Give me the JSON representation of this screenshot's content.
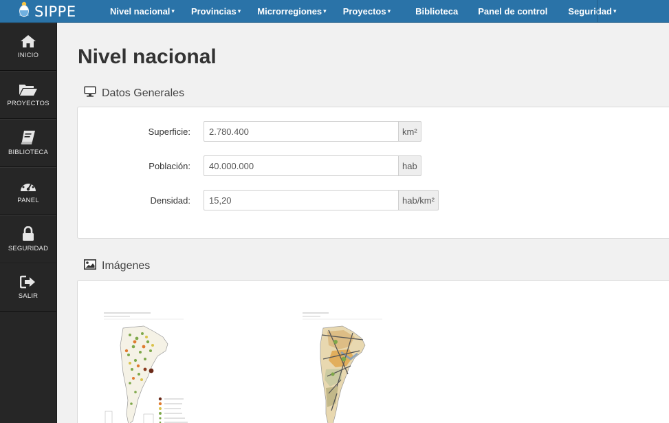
{
  "app": {
    "brand": "SIPPE"
  },
  "nav": {
    "items": [
      {
        "label": "Nivel nacional",
        "caret": "▾"
      },
      {
        "label": "Provincias",
        "caret": "▾"
      },
      {
        "label": "Microrregiones",
        "caret": "▾"
      },
      {
        "label": "Proyectos",
        "caret": "▾"
      },
      {
        "label": "Biblioteca",
        "caret": ""
      },
      {
        "label": "Panel de control",
        "caret": ""
      },
      {
        "label": "Seguridad",
        "caret": "▾"
      }
    ]
  },
  "sidebar": {
    "items": [
      {
        "label": "INICIO",
        "icon": "home-icon"
      },
      {
        "label": "PROYECTOS",
        "icon": "folder-open-icon"
      },
      {
        "label": "BIBLIOTECA",
        "icon": "book-icon"
      },
      {
        "label": "PANEL",
        "icon": "dashboard-icon"
      },
      {
        "label": "SEGURIDAD",
        "icon": "lock-icon"
      },
      {
        "label": "SALIR",
        "icon": "sign-out-icon"
      }
    ]
  },
  "page": {
    "title": "Nivel nacional"
  },
  "datos_generales": {
    "heading": "Datos Generales",
    "fields": [
      {
        "label": "Superficie:",
        "value": "2.780.400",
        "unit": "km²"
      },
      {
        "label": "Población:",
        "value": "40.000.000",
        "unit": "hab"
      },
      {
        "label": "Densidad:",
        "value": "15,20",
        "unit": "hab/km²"
      }
    ]
  },
  "imagenes": {
    "heading": "Imágenes"
  },
  "colors": {
    "topbar": "#2a73a8",
    "sidebar": "#262626",
    "background": "#f1f1f1"
  }
}
